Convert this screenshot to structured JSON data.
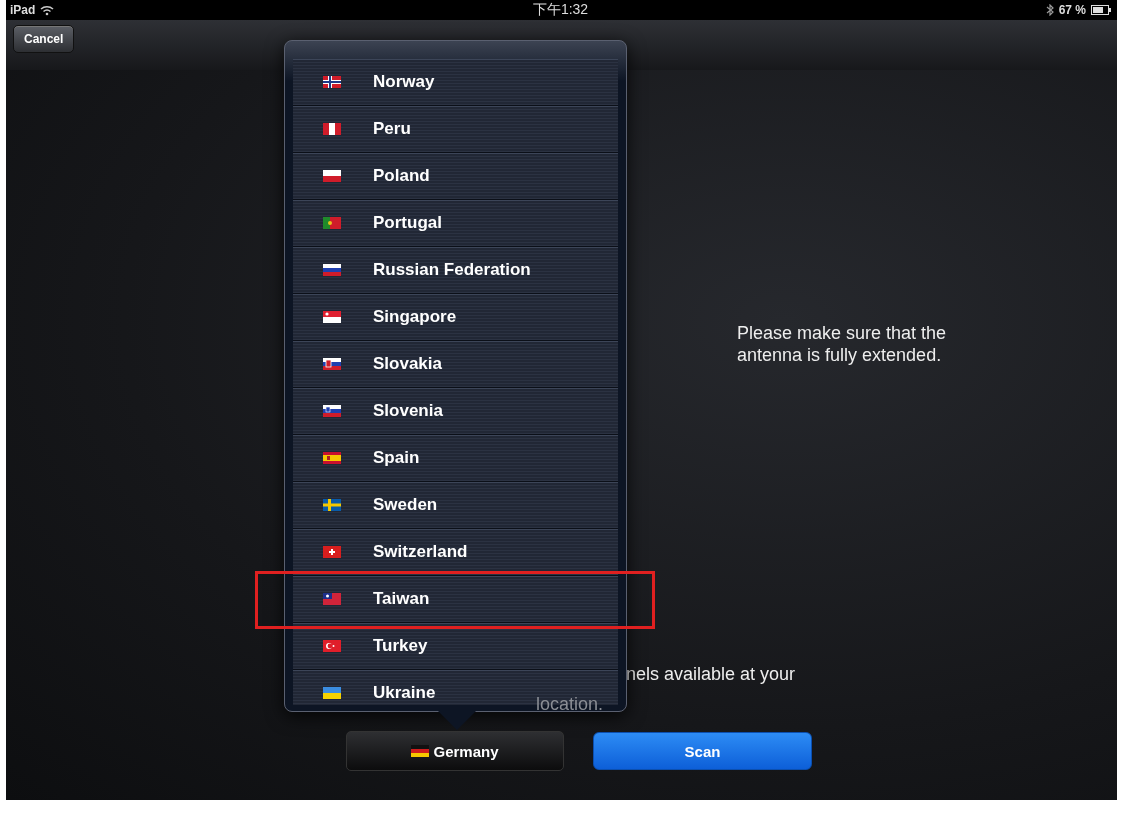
{
  "status_bar": {
    "device": "iPad",
    "time": "下午1:32",
    "battery": "67 %"
  },
  "nav_bar": {
    "cancel": "Cancel"
  },
  "message": "Please make sure that the antenna is fully extended.",
  "background_text": {
    "line_1": "nels available at your",
    "line_2": "location."
  },
  "country_list": [
    {
      "name": "Norway",
      "kind": "no",
      "highlighted": false
    },
    {
      "name": "Peru",
      "kind": "pe",
      "highlighted": false
    },
    {
      "name": "Poland",
      "kind": "pl",
      "highlighted": false
    },
    {
      "name": "Portugal",
      "kind": "pt",
      "highlighted": false
    },
    {
      "name": "Russian Federation",
      "kind": "ru",
      "highlighted": false
    },
    {
      "name": "Singapore",
      "kind": "sg",
      "highlighted": false
    },
    {
      "name": "Slovakia",
      "kind": "sk",
      "highlighted": false
    },
    {
      "name": "Slovenia",
      "kind": "si",
      "highlighted": false
    },
    {
      "name": "Spain",
      "kind": "es",
      "highlighted": false
    },
    {
      "name": "Sweden",
      "kind": "se",
      "highlighted": false
    },
    {
      "name": "Switzerland",
      "kind": "ch",
      "highlighted": false
    },
    {
      "name": "Taiwan",
      "kind": "tw",
      "highlighted": true
    },
    {
      "name": "Turkey",
      "kind": "tr",
      "highlighted": false
    },
    {
      "name": "Ukraine",
      "kind": "ua",
      "highlighted": false
    }
  ],
  "country_button": {
    "label": "Germany",
    "kind": "de"
  },
  "scan_button": "Scan"
}
